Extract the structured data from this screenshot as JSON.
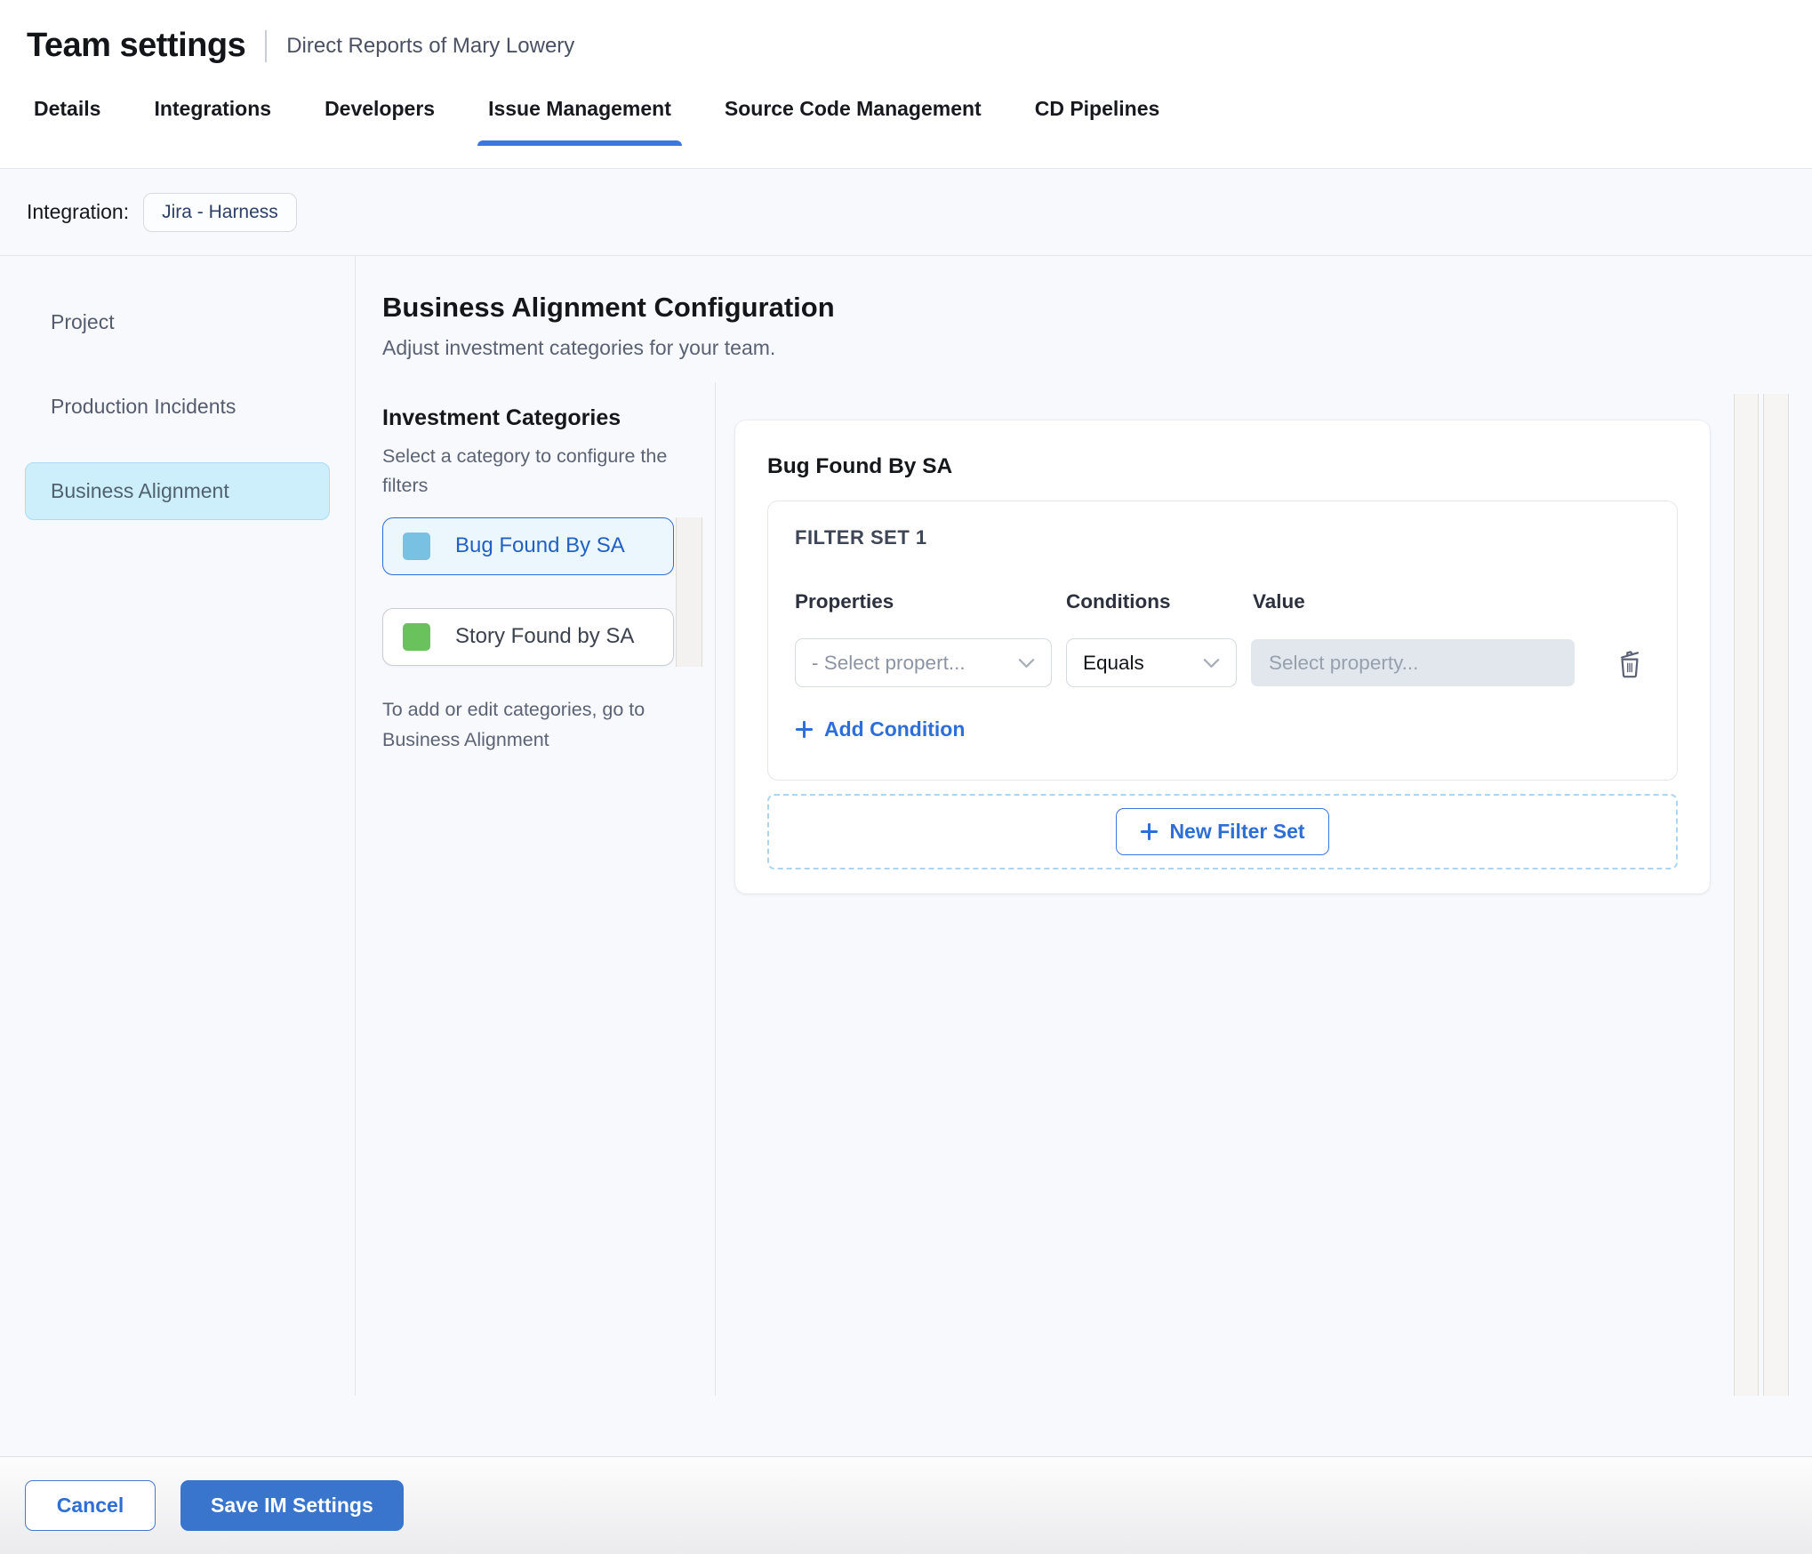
{
  "header": {
    "title": "Team settings",
    "subtitle": "Direct Reports of Mary Lowery"
  },
  "tabs": [
    {
      "label": "Details"
    },
    {
      "label": "Integrations"
    },
    {
      "label": "Developers"
    },
    {
      "label": "Issue Management"
    },
    {
      "label": "Source Code Management"
    },
    {
      "label": "CD Pipelines"
    }
  ],
  "integration": {
    "label": "Integration:",
    "chip": "Jira - Harness"
  },
  "sidebar": {
    "items": [
      {
        "label": "Project"
      },
      {
        "label": "Production Incidents"
      },
      {
        "label": "Business Alignment"
      }
    ]
  },
  "main": {
    "title": "Business Alignment Configuration",
    "subtitle": "Adjust investment categories for your team.",
    "categories": {
      "title": "Investment Categories",
      "subtitle": "Select a category to configure the filters",
      "items": [
        {
          "label": "Bug Found By SA",
          "color": "#79c1e2"
        },
        {
          "label": "Story Found by SA",
          "color": "#69c25c"
        }
      ],
      "footnote": "To add or edit categories, go to Business Alignment"
    },
    "filter_panel": {
      "title": "Bug Found By SA",
      "filter_set": {
        "title": "FILTER SET 1",
        "columns": {
          "properties": "Properties",
          "conditions": "Conditions",
          "value": "Value"
        },
        "property_placeholder": "- Select propert...",
        "condition_selected": "Equals",
        "value_placeholder": "Select property...",
        "add_condition_label": "Add Condition"
      },
      "new_filter_set_label": "New Filter Set"
    }
  },
  "footer": {
    "cancel": "Cancel",
    "save": "Save IM Settings"
  },
  "colors": {
    "accent_blue": "#3b76d8",
    "active_tab_underline": "#3b78dd",
    "sidebar_active_bg": "#cdeefb",
    "category_active_border": "#2e6cd8",
    "category_active_text": "#2160c4",
    "bug_swatch": "#79c1e2",
    "story_swatch": "#69c25c",
    "link_blue": "#2d6fd9",
    "save_button_bg": "#3974cd",
    "content_background": "#f7f9fc"
  }
}
